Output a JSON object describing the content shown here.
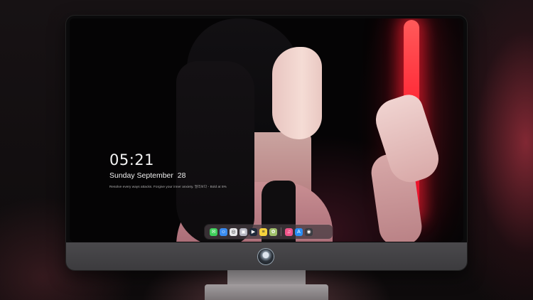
{
  "lock_screen": {
    "time": "05:21",
    "date": "Sunday September  28",
    "subtitle": "Resolve every ways attacks. Forgive your inner anxiety. 멀리보다 - Bold at 5%"
  },
  "dock": {
    "apps": [
      {
        "name": "messages-icon",
        "glyph": "✉",
        "color": "#3ecf5a"
      },
      {
        "name": "finder-icon",
        "glyph": "☺",
        "color": "#3a8cf0"
      },
      {
        "name": "safari-icon",
        "glyph": "◎",
        "color": "#e8e8ea"
      },
      {
        "name": "preview-icon",
        "glyph": "▣",
        "color": "#b5b6c0"
      },
      {
        "name": "finalcut-icon",
        "glyph": "▶",
        "color": "#1f2a3a"
      },
      {
        "name": "notes-icon",
        "glyph": "≡",
        "color": "#f6d23c"
      },
      {
        "name": "photos-icon",
        "glyph": "✿",
        "color": "#9fbf6a"
      },
      {
        "name": "music-icon",
        "glyph": "♫",
        "color": "#f0558a"
      },
      {
        "name": "appstore-icon",
        "glyph": "A",
        "color": "#2a8ef5"
      },
      {
        "name": "camera-icon",
        "glyph": "◉",
        "color": "#3b3d42"
      }
    ]
  },
  "colors": {
    "neon": "#ff2030",
    "bezel": "#0a0a0b",
    "chin": "#444346"
  }
}
